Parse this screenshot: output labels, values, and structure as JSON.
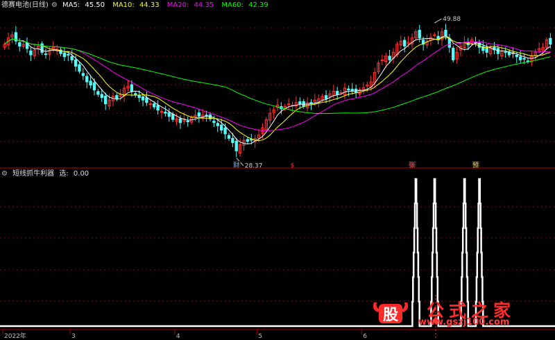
{
  "main_legend": {
    "title": "德赛电池(日线)",
    "ma5_label": "MA5:",
    "ma5": "45.50",
    "ma10_label": "MA10:",
    "ma10": "44.33",
    "ma20_label": "MA20:",
    "ma20": "44.35",
    "ma60_label": "MA60:",
    "ma60": "42.39"
  },
  "sub_legend": {
    "title": "短线抓牛利器",
    "label": "选:",
    "value": "0.00"
  },
  "annotations": {
    "high": "49.88",
    "low": "28.37"
  },
  "event_markers": [
    {
      "label": "财",
      "index": 62
    },
    {
      "label": "$",
      "index": 77
    },
    {
      "label": "张",
      "index": 109
    },
    {
      "label": "预",
      "index": 126
    }
  ],
  "x_axis_labels": [
    {
      "text": "2022年",
      "index": 0
    },
    {
      "text": "3",
      "index": 18
    },
    {
      "text": "4",
      "index": 46
    },
    {
      "text": "5",
      "index": 68
    },
    {
      "text": "6",
      "index": 96
    }
  ],
  "watermark": {
    "logo_char": "股",
    "cn": "公式之家",
    "url": "www.gszj100.com"
  },
  "colors": {
    "up": "#ff3232",
    "down": "#54fcfc",
    "ma5": "#ffffff",
    "ma10": "#ffff00",
    "ma20": "#ff00ff",
    "ma60": "#00ff00",
    "grid": "#8b0000",
    "signal": "#ffffff"
  },
  "chart_data": {
    "type": "candlestick",
    "y_range": [
      27,
      52
    ],
    "ohlc_close_approx": [
      46.5,
      47.5,
      48.0,
      47.0,
      46.2,
      46.5,
      45.8,
      44.8,
      45.6,
      46.2,
      45.2,
      44.9,
      45.5,
      46.0,
      45.7,
      45.0,
      44.5,
      44.8,
      44.0,
      43.0,
      42.2,
      41.5,
      40.5,
      40.0,
      39.2,
      38.5,
      38.0,
      37.0,
      37.6,
      38.2,
      37.8,
      38.5,
      39.5,
      39.8,
      39.0,
      38.4,
      38.0,
      37.6,
      37.2,
      37.0,
      36.5,
      36.0,
      35.8,
      35.5,
      35.0,
      34.5,
      34.6,
      34.0,
      34.6,
      34.2,
      34.8,
      35.2,
      35.0,
      35.2,
      35.0,
      34.6,
      34.0,
      33.5,
      32.8,
      32.2,
      31.5,
      30.8,
      29.5,
      30.5,
      31.2,
      31.0,
      31.2,
      31.5,
      32.0,
      33.2,
      34.5,
      35.5,
      36.0,
      36.8,
      36.2,
      36.6,
      37.0,
      36.8,
      37.2,
      37.0,
      36.6,
      37.2,
      37.0,
      37.6,
      37.8,
      38.2,
      37.8,
      38.6,
      39.0,
      38.5,
      38.8,
      39.5,
      39.2,
      39.0,
      38.8,
      39.2,
      39.6,
      40.0,
      40.5,
      42.0,
      43.5,
      44.0,
      44.6,
      44.0,
      45.2,
      46.5,
      47.0,
      46.2,
      46.8,
      47.5,
      48.5,
      47.5,
      46.5,
      47.0,
      47.6,
      48.0,
      47.2,
      48.5,
      47.8,
      46.0,
      44.0,
      45.2,
      46.2,
      46.8,
      46.4,
      47.2,
      46.8,
      46.0,
      45.5,
      45.2,
      46.0,
      45.6,
      45.0,
      45.4,
      45.2,
      44.8,
      45.0,
      44.5,
      44.0,
      44.2,
      43.8,
      44.6,
      45.2,
      45.8,
      46.0,
      47.2,
      46.5
    ],
    "annotations": [
      {
        "text": "49.88",
        "index": 115,
        "price": 49.88
      },
      {
        "text": "28.37",
        "index": 62,
        "price": 28.37
      }
    ],
    "signal_series": {
      "name": "选",
      "baseline": 0,
      "spikes": [
        {
          "start": 109,
          "end": 111
        },
        {
          "start": 114,
          "end": 116
        },
        {
          "start": 122,
          "end": 124
        },
        {
          "start": 126,
          "end": 128
        }
      ]
    }
  }
}
